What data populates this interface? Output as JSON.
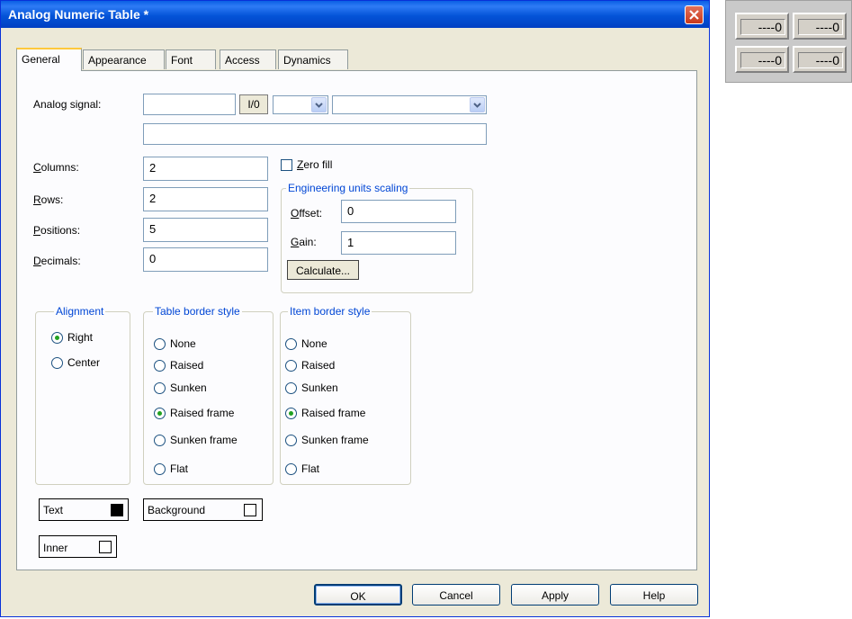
{
  "window": {
    "title": "Analog Numeric Table *"
  },
  "tabs": [
    "General",
    "Appearance",
    "Font",
    "Access",
    "Dynamics"
  ],
  "analog_signal": {
    "label": "Analog signal:",
    "io_button": "I/0",
    "value": "",
    "combo1": "",
    "combo2": "",
    "expression": ""
  },
  "fields": {
    "columns": {
      "label": "Columns:",
      "value": "2"
    },
    "rows": {
      "label": "Rows:",
      "value": "2"
    },
    "positions": {
      "label": "Positions:",
      "value": "5"
    },
    "decimals": {
      "label": "Decimals:",
      "value": "0"
    }
  },
  "zero_fill": {
    "label": "Zero fill",
    "checked": false
  },
  "scaling": {
    "title": "Engineering units scaling",
    "offset_label": "Offset:",
    "offset_value": "0",
    "gain_label": "Gain:",
    "gain_value": "1",
    "calculate": "Calculate..."
  },
  "alignment": {
    "title": "Alignment",
    "options": [
      "Right",
      "Center"
    ],
    "selected": "Right"
  },
  "table_border": {
    "title": "Table border style",
    "options": [
      "None",
      "Raised",
      "Sunken",
      "Raised frame",
      "Sunken frame",
      "Flat"
    ],
    "selected": "Raised frame"
  },
  "item_border": {
    "title": "Item border style",
    "options": [
      "None",
      "Raised",
      "Sunken",
      "Raised frame",
      "Sunken frame",
      "Flat"
    ],
    "selected": "Raised frame"
  },
  "colors": {
    "text_label": "Text",
    "text_color": "#000000",
    "background_label": "Background",
    "background_color": "#ffffff",
    "inner_label": "Inner",
    "inner_color": "#ffffff"
  },
  "buttons": {
    "ok": "OK",
    "cancel": "Cancel",
    "apply": "Apply",
    "help": "Help"
  },
  "preview": {
    "cells": [
      "----0",
      "----0",
      "----0",
      "----0"
    ]
  },
  "theme": {
    "titlebar": "#0054e3",
    "dialog_bg": "#ece9d8",
    "panel_bg": "#fcfcfe",
    "group_title": "#0046d5",
    "close": "#c9381a"
  }
}
